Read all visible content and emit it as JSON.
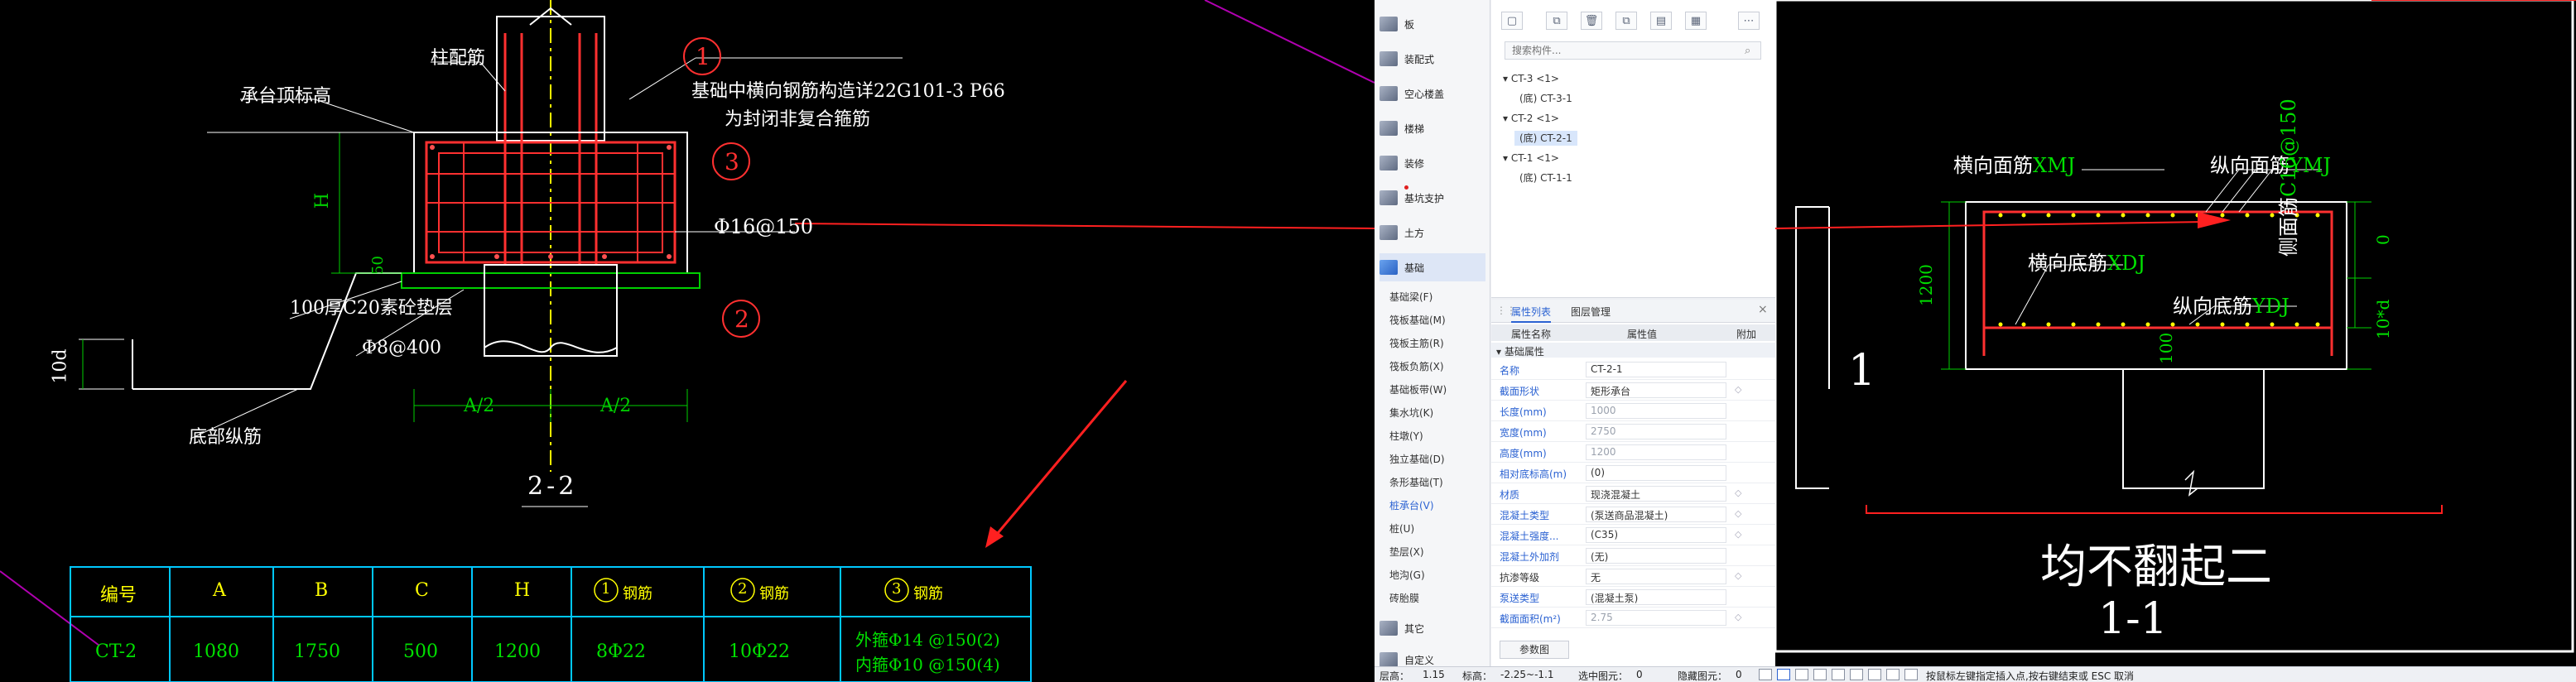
{
  "left_drawing": {
    "label_column_rebar": "柱配筋",
    "label_cap_elev": "承台顶标高",
    "note_line1": "基础中横向钢筋构造详22G101-3 P66",
    "note_line2": "为封闭非复合箍筋",
    "label_side_rebar": "Φ16@150",
    "label_H": "H",
    "label_50": "50",
    "label_cushion": "100厚C20素砼垫层",
    "label_stirrup": "Φ8@400",
    "label_10d": "10d",
    "label_bottom_rebar": "底部纵筋",
    "label_a2_left": "A/2",
    "label_a2_right": "A/2",
    "section_title": "2-2",
    "circle_1": "1",
    "circle_2": "2",
    "circle_3": "3",
    "table": {
      "headers": [
        "编号",
        "A",
        "B",
        "C",
        "H",
        "钢筋",
        "钢筋",
        "钢筋"
      ],
      "header_marks": [
        "1",
        "2",
        "3"
      ],
      "row": [
        "CT-2",
        "1080",
        "1750",
        "500",
        "1200",
        "8Φ22",
        "10Φ22"
      ],
      "row_last_line1": "外箍Φ14 @150(2)",
      "row_last_line2": "内箍Φ10 @150(4)"
    }
  },
  "nav": {
    "top_items": [
      {
        "label": "板",
        "icon": "slab-icon"
      },
      {
        "label": "装配式",
        "icon": "prefab-icon"
      },
      {
        "label": "空心楼盖",
        "icon": "hollow-floor-icon"
      },
      {
        "label": "楼梯",
        "icon": "stair-icon"
      },
      {
        "label": "装修",
        "icon": "decoration-icon"
      },
      {
        "label": "基坑支护",
        "icon": "pit-support-icon"
      },
      {
        "label": "土方",
        "icon": "earthwork-icon"
      },
      {
        "label": "基础",
        "icon": "foundation-icon"
      }
    ],
    "sub_items": [
      "基础梁(F)",
      "筏板基础(M)",
      "筏板主筋(R)",
      "筏板负筋(X)",
      "基础板带(W)",
      "集水坑(K)",
      "柱墩(Y)",
      "独立基础(D)",
      "条形基础(T)",
      "桩承台(V)",
      "桩(U)",
      "垫层(X)",
      "地沟(G)",
      "砖胎膜"
    ],
    "bottom_items": [
      {
        "label": "其它",
        "icon": "other-icon"
      },
      {
        "label": "自定义",
        "icon": "custom-icon"
      }
    ]
  },
  "tree": {
    "search_placeholder": "搜索构件...",
    "nodes": [
      {
        "label": "▾ CT-3 <1>",
        "level": 0
      },
      {
        "label": "(底) CT-3-1",
        "level": 1
      },
      {
        "label": "▾ CT-2 <1>",
        "level": 0
      },
      {
        "label": "(底) CT-2-1",
        "level": 1,
        "selected": true
      },
      {
        "label": "▾ CT-1 <1>",
        "level": 0
      },
      {
        "label": "(底) CT-1-1",
        "level": 1
      }
    ]
  },
  "props": {
    "tab_props": "属性列表",
    "tab_layers": "图层管理",
    "col_name": "属性名称",
    "col_value": "属性值",
    "col_add": "附加",
    "group": "▾ 基础属性",
    "rows": [
      {
        "name": "名称",
        "value": "CT-2-1",
        "gray": false,
        "dark": false
      },
      {
        "name": "截面形状",
        "value": "矩形承台",
        "gray": false,
        "dark": false,
        "add": true
      },
      {
        "name": "长度(mm)",
        "value": "1000",
        "gray": true,
        "dark": false
      },
      {
        "name": "宽度(mm)",
        "value": "2750",
        "gray": true,
        "dark": false
      },
      {
        "name": "高度(mm)",
        "value": "1200",
        "gray": true,
        "dark": false
      },
      {
        "name": "相对底标高(m)",
        "value": "(0)",
        "gray": false,
        "dark": false
      },
      {
        "name": "材质",
        "value": "现浇混凝土",
        "gray": false,
        "dark": false,
        "add": true
      },
      {
        "name": "混凝土类型",
        "value": "(泵送商品混凝土)",
        "gray": false,
        "dark": false,
        "add": true
      },
      {
        "name": "混凝土强度...",
        "value": "(C35)",
        "gray": false,
        "dark": false,
        "add": true
      },
      {
        "name": "混凝土外加剂",
        "value": "(无)",
        "gray": false,
        "dark": false
      },
      {
        "name": "抗渗等级",
        "value": "无",
        "gray": false,
        "dark": true,
        "add": true
      },
      {
        "name": "泵送类型",
        "value": "(混凝土泵)",
        "gray": false,
        "dark": false
      },
      {
        "name": "截面面积(m²)",
        "value": "2.75",
        "gray": true,
        "dark": false,
        "add": true
      }
    ],
    "params_button": "参数图"
  },
  "status": {
    "floor": "层高：",
    "floor_val": "1.15",
    "elev": "标高：",
    "elev_val": "-2.25~-1.1",
    "selected": "选中图元：",
    "selected_val": "0",
    "hidden": "隐藏图元：",
    "hidden_val": "0",
    "hint": "按鼠标左键指定插入点,按右键结束或 ESC 取消"
  },
  "right_drawing": {
    "label_xmj": "横向面筋",
    "label_xmj_code": "XMJ",
    "label_ymj": "纵向面筋",
    "label_ymj_code": "YMJ",
    "label_xdj": "横向底筋",
    "label_xdj_code": "XDJ",
    "label_ydj": "纵向底筋",
    "label_ydj_code": "YDJ",
    "label_side": "侧面筋",
    "label_side_code": "C16@150",
    "label_1200": "1200",
    "label_0": "0",
    "label_10d": "10*d",
    "label_100": "100",
    "label_1": "1",
    "big_note": "均不翻起二",
    "section_title": "1-1"
  },
  "colors": {
    "cad_white": "#ffffff",
    "cad_red": "#ff2020",
    "cad_green": "#00e000",
    "cad_cyan": "#00c8ff",
    "cad_yellow": "#ffff00",
    "cad_magenta": "#d000d0",
    "accent": "#2b62d2"
  }
}
